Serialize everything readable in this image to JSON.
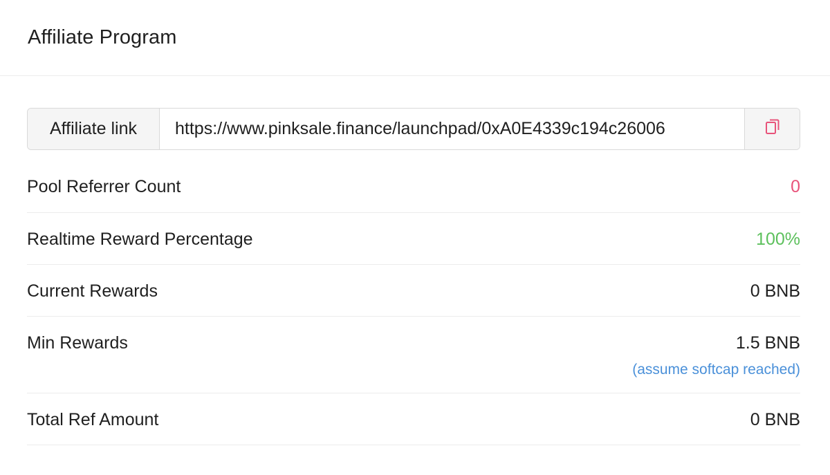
{
  "header": {
    "title": "Affiliate Program"
  },
  "affiliate": {
    "label": "Affiliate link",
    "url": "https://www.pinksale.finance/launchpad/0xA0E4339c194c26006",
    "copy_icon": "copy-icon"
  },
  "stats": {
    "pool_referrer_count": {
      "label": "Pool Referrer Count",
      "value": "0"
    },
    "realtime_reward_percentage": {
      "label": "Realtime Reward Percentage",
      "value": "100%"
    },
    "current_rewards": {
      "label": "Current Rewards",
      "value": "0 BNB"
    },
    "min_rewards": {
      "label": "Min Rewards",
      "value": "1.5 BNB",
      "note": "(assume softcap reached)"
    },
    "total_ref_amount": {
      "label": "Total Ref Amount",
      "value": "0 BNB"
    }
  },
  "colors": {
    "pink": "#e8537a",
    "green": "#5cc05c",
    "blue": "#4a90d9",
    "text": "#1f1f1f"
  }
}
